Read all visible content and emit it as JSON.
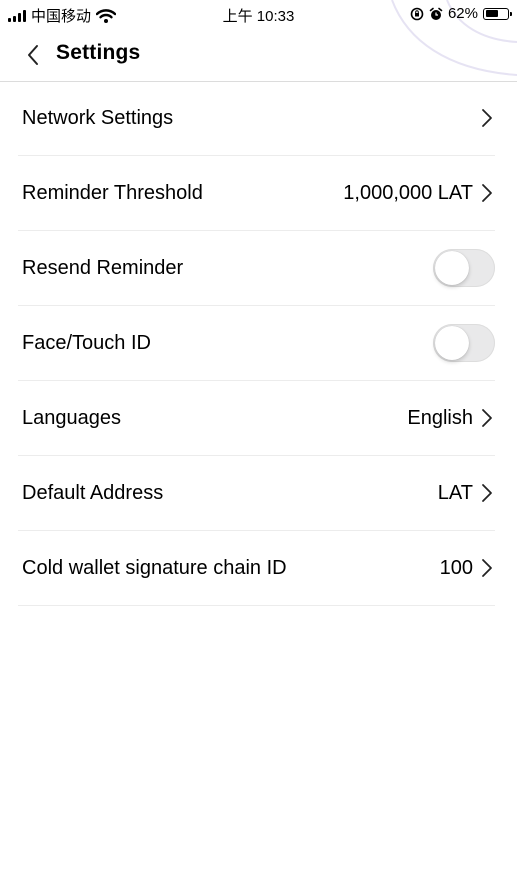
{
  "status_bar": {
    "carrier": "中国移动",
    "time": "上午 10:33",
    "battery_percent": "62%",
    "battery_level": 0.62,
    "icons": [
      "signal-icon",
      "wifi-icon",
      "rotation-lock-icon",
      "alarm-icon",
      "battery-icon"
    ]
  },
  "nav": {
    "back_icon": "chevron-left-icon",
    "title": "Settings"
  },
  "settings": {
    "network": {
      "label": "Network Settings"
    },
    "reminder_threshold": {
      "label": "Reminder Threshold",
      "value": "1,000,000 LAT"
    },
    "resend_reminder": {
      "label": "Resend Reminder",
      "enabled": false
    },
    "face_touch_id": {
      "label": "Face/Touch ID",
      "enabled": false
    },
    "languages": {
      "label": "Languages",
      "value": "English"
    },
    "default_address": {
      "label": "Default Address",
      "value": "LAT"
    },
    "cold_wallet_chain_id": {
      "label": "Cold wallet signature chain ID",
      "value": "100"
    }
  },
  "colors": {
    "divider": "#ececec",
    "toggle_off": "#e9e9ea",
    "text": "#000000"
  }
}
